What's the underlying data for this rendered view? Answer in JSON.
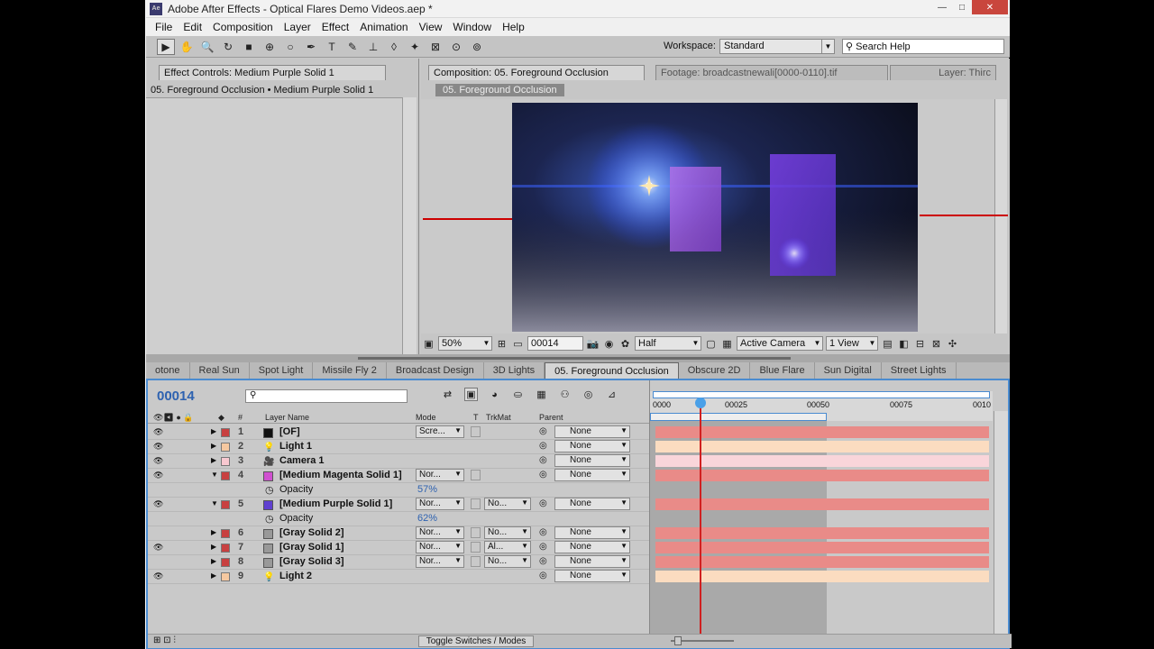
{
  "window": {
    "title": "Adobe After Effects - Optical Flares Demo Videos.aep *",
    "app_icon": "Ae",
    "buttons": [
      "—",
      "□",
      "✕"
    ]
  },
  "menu": [
    "File",
    "Edit",
    "Composition",
    "Layer",
    "Effect",
    "Animation",
    "View",
    "Window",
    "Help"
  ],
  "toolbar": {
    "tools": [
      "▶",
      "✋",
      "🔍",
      "↻",
      "■",
      "⊕",
      "○",
      "✒",
      "T",
      "✎",
      "⊥",
      "◊",
      "✦",
      "⊠",
      "⊙",
      "⊚"
    ],
    "workspace_label": "Workspace:",
    "workspace_value": "Standard",
    "search_placeholder": "Search Help"
  },
  "effect_controls": {
    "tab": "Effect Controls: Medium Purple Solid 1",
    "breadcrumb": "05. Foreground Occlusion • Medium Purple Solid 1"
  },
  "composition": {
    "tab": "Composition: 05. Foreground Occlusion",
    "footage_tab": "Footage: broadcastnewali[0000-0110].tif",
    "layer_tab": "Layer: Thirc",
    "comp_label": "05. Foreground Occlusion"
  },
  "viewer": {
    "zoom": "50%",
    "timecode": "00014",
    "resolution": "Half",
    "camera": "Active Camera",
    "views": "1 View"
  },
  "comp_tabs": [
    "otone",
    "Real Sun",
    "Spot Light",
    "Missile Fly 2",
    "Broadcast Design",
    "3D Lights",
    "05. Foreground Occlusion",
    "Obscure 2D",
    "Blue Flare",
    "Sun Digital",
    "Street Lights"
  ],
  "timeline": {
    "timecode": "00014",
    "search_placeholder": "",
    "headers": {
      "num": "#",
      "name": "Layer Name",
      "mode": "Mode",
      "t": "T",
      "trkmat": "TrkMat",
      "parent": "Parent"
    },
    "ruler": [
      "0000",
      "00025",
      "00050",
      "00075",
      "0010"
    ],
    "toggle_label": "Toggle Switches / Modes",
    "layers": [
      {
        "num": "1",
        "name": "[OF]",
        "mode": "Scre...",
        "trk": "",
        "parent": "None",
        "label_color": "#c84040",
        "swatch": "#111111",
        "visible": true,
        "twirled": false
      },
      {
        "num": "2",
        "name": "Light 1",
        "mode": "",
        "trk": "",
        "parent": "None",
        "label_color": "#f5c8a0",
        "swatch": "",
        "visible": true,
        "twirled": false
      },
      {
        "num": "3",
        "name": "Camera 1",
        "mode": "",
        "trk": "",
        "parent": "None",
        "label_color": "#f8c8d0",
        "swatch": "",
        "visible": true,
        "twirled": false
      },
      {
        "num": "4",
        "name": "[Medium Magenta Solid 1]",
        "mode": "Nor...",
        "trk": "",
        "parent": "None",
        "label_color": "#c84040",
        "swatch": "#d050d0",
        "visible": true,
        "twirled": true
      },
      {
        "prop": "Opacity",
        "value": "57%"
      },
      {
        "num": "5",
        "name": "[Medium Purple Solid 1]",
        "mode": "Nor...",
        "trk": "No...",
        "parent": "None",
        "label_color": "#c84040",
        "swatch": "#6040d0",
        "visible": true,
        "twirled": true
      },
      {
        "prop": "Opacity",
        "value": "62%"
      },
      {
        "num": "6",
        "name": "[Gray Solid 2]",
        "mode": "Nor...",
        "trk": "No...",
        "parent": "None",
        "label_color": "#c84040",
        "swatch": "#999999",
        "visible": false,
        "twirled": false
      },
      {
        "num": "7",
        "name": "[Gray Solid 1]",
        "mode": "Nor...",
        "trk": "Al...",
        "parent": "None",
        "label_color": "#c84040",
        "swatch": "#999999",
        "visible": true,
        "twirled": false
      },
      {
        "num": "8",
        "name": "[Gray Solid 3]",
        "mode": "Nor...",
        "trk": "No...",
        "parent": "None",
        "label_color": "#c84040",
        "swatch": "#999999",
        "visible": false,
        "twirled": false
      },
      {
        "num": "9",
        "name": "Light 2",
        "mode": "",
        "trk": "",
        "parent": "None",
        "label_color": "#f5c8a0",
        "swatch": "",
        "visible": true,
        "twirled": false
      }
    ]
  },
  "colors": {
    "accent": "#4a8bd0",
    "timecode": "#2e62b0",
    "bar_red": "#e98b88",
    "bar_peach": "#fbdcc0",
    "bar_pink": "#f9d5da",
    "playhead": "#d02020"
  }
}
